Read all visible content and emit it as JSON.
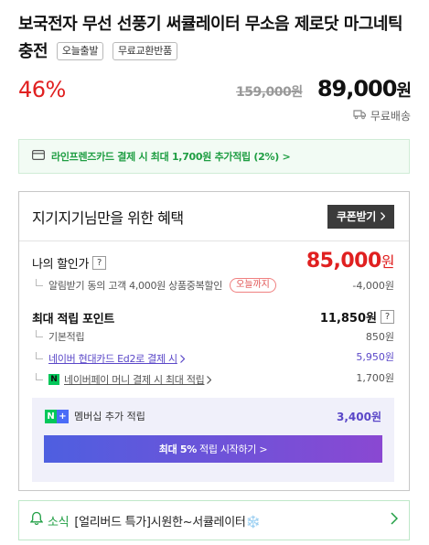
{
  "product": {
    "title": "보국전자 무선 선풍기 써큘레이터 무소음 제로닷 마그네틱충전",
    "tags": [
      "오늘출발",
      "무료교환반품"
    ]
  },
  "price": {
    "discount": "46%",
    "original": "159,000원",
    "sale_amount": "89,000",
    "sale_unit": "원",
    "shipping": "무료배송"
  },
  "card_banner": "라인프렌즈카드 결제 시 최대 1,700원 추가적립 (2%) >",
  "benefits": {
    "title": "지기지기님만을 위한 혜택",
    "coupon_button": "쿠폰받기",
    "my_price_label": "나의 할인가",
    "my_price_amount": "85,000",
    "my_price_unit": "원",
    "alarm_label": "알림받기 동의 고객 4,000원 상품중복할인",
    "alarm_badge": "오늘까지",
    "alarm_value": "-4,000원",
    "points_label": "최대 적립 포인트",
    "points_value": "11,850원",
    "basic_label": "기본적립",
    "basic_value": "850원",
    "card_label": "네이버 현대카드 Ed2로 결제 시",
    "card_value": "5,950원",
    "npay_label": "네이버페이 머니 결제 시 최대 적립",
    "npay_value": "1,700원",
    "member_label": "멤버십 추가 적립",
    "member_value": "3,400원",
    "start_bold": "최대 5%",
    "start_rest": "적립 시작하기 >"
  },
  "news": {
    "tag": "소식",
    "text": "[얼리버드 특가]시원한~서큘레이터❄️"
  },
  "colors": {
    "discount_red": "#e02020",
    "naver_green": "#1f9e43",
    "purple": "#5a47c8"
  }
}
